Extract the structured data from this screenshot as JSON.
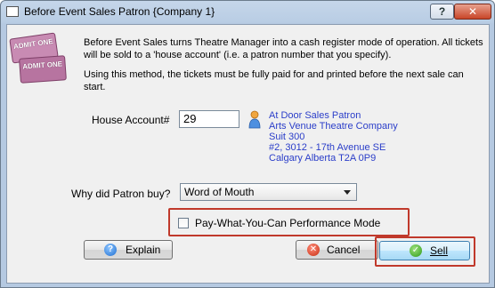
{
  "window": {
    "title": "Before Event Sales Patron {Company 1}",
    "help_label": "?",
    "close_label": "✕"
  },
  "tickets": {
    "top": "ADMIT ONE",
    "bottom": "ADMIT ONE"
  },
  "description": {
    "paragraph1": "Before Event Sales turns Theatre Manager into a cash register mode of operation.  All tickets will be sold to a 'house account' (i.e. a patron number that you specify).",
    "paragraph2": "Using this method, the tickets must be fully paid for and printed before the next sale can start."
  },
  "house_account": {
    "label": "House Account#",
    "value": "29",
    "patron_icon": "person-icon",
    "address": [
      "At Door Sales Patron",
      "Arts Venue Theatre Company",
      "Suit 300",
      "#2, 3012 - 17th Avenue SE",
      "Calgary Alberta  T2A 0P9"
    ]
  },
  "why_buy": {
    "label": "Why did Patron buy?",
    "selected": "Word of Mouth"
  },
  "pwyc": {
    "label": "Pay-What-You-Can Performance Mode",
    "checked": false
  },
  "buttons": {
    "explain": "Explain",
    "cancel": "Cancel",
    "sell": "Sell"
  },
  "colors": {
    "address_text": "#2b3ec9",
    "highlight_box": "#c0392b",
    "ticket": "#b774a0"
  }
}
